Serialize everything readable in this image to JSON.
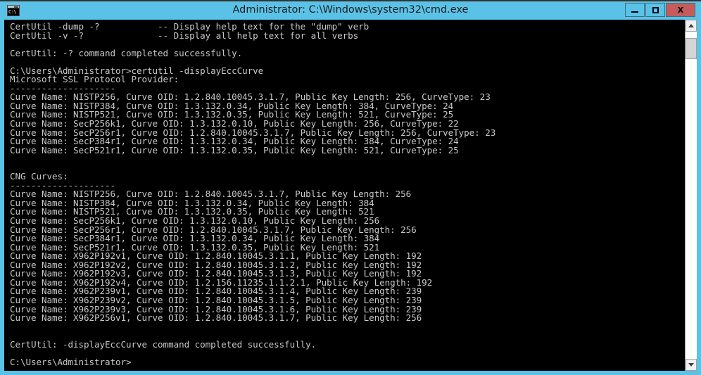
{
  "window": {
    "title": "Administrator: C:\\Windows\\system32\\cmd.exe",
    "icon_text": "C:\\",
    "titlebar_color": "#5bc2e7",
    "close_button_color": "#c75b5b",
    "controls": {
      "minimize_label": "",
      "maximize_label": "",
      "close_label": "X"
    }
  },
  "console": {
    "background_color": "#000000",
    "text_color": "#c8c8c8",
    "lines": [
      "CertUtil -dump -?           -- Display help text for the \"dump\" verb",
      "CertUtil -v -?              -- Display all help text for all verbs",
      "",
      "CertUtil: -? command completed successfully.",
      "",
      "C:\\Users\\Administrator>certutil -displayEccCurve",
      "Microsoft SSL Protocol Provider:",
      "--------------------",
      "Curve Name: NISTP256, Curve OID: 1.2.840.10045.3.1.7, Public Key Length: 256, CurveType: 23",
      "Curve Name: NISTP384, Curve OID: 1.3.132.0.34, Public Key Length: 384, CurveType: 24",
      "Curve Name: NISTP521, Curve OID: 1.3.132.0.35, Public Key Length: 521, CurveType: 25",
      "Curve Name: SecP256k1, Curve OID: 1.3.132.0.10, Public Key Length: 256, CurveType: 22",
      "Curve Name: SecP256r1, Curve OID: 1.2.840.10045.3.1.7, Public Key Length: 256, CurveType: 23",
      "Curve Name: SecP384r1, Curve OID: 1.3.132.0.34, Public Key Length: 384, CurveType: 24",
      "Curve Name: SecP521r1, Curve OID: 1.3.132.0.35, Public Key Length: 521, CurveType: 25",
      "",
      "",
      "CNG Curves:",
      "--------------------",
      "Curve Name: NISTP256, Curve OID: 1.2.840.10045.3.1.7, Public Key Length: 256",
      "Curve Name: NISTP384, Curve OID: 1.3.132.0.34, Public Key Length: 384",
      "Curve Name: NISTP521, Curve OID: 1.3.132.0.35, Public Key Length: 521",
      "Curve Name: SecP256k1, Curve OID: 1.3.132.0.10, Public Key Length: 256",
      "Curve Name: SecP256r1, Curve OID: 1.2.840.10045.3.1.7, Public Key Length: 256",
      "Curve Name: SecP384r1, Curve OID: 1.3.132.0.34, Public Key Length: 384",
      "Curve Name: SecP521r1, Curve OID: 1.3.132.0.35, Public Key Length: 521",
      "Curve Name: X962P192v1, Curve OID: 1.2.840.10045.3.1.1, Public Key Length: 192",
      "Curve Name: X962P192v2, Curve OID: 1.2.840.10045.3.1.2, Public Key Length: 192",
      "Curve Name: X962P192v3, Curve OID: 1.2.840.10045.3.1.3, Public Key Length: 192",
      "Curve Name: X962P192v4, Curve OID: 1.2.156.11235.1.1.2.1, Public Key Length: 192",
      "Curve Name: X962P239v1, Curve OID: 1.2.840.10045.3.1.4, Public Key Length: 239",
      "Curve Name: X962P239v2, Curve OID: 1.2.840.10045.3.1.5, Public Key Length: 239",
      "Curve Name: X962P239v3, Curve OID: 1.2.840.10045.3.1.6, Public Key Length: 239",
      "Curve Name: X962P256v1, Curve OID: 1.2.840.10045.3.1.7, Public Key Length: 256",
      "",
      "",
      "CertUtil: -displayEccCurve command completed successfully.",
      "",
      "C:\\Users\\Administrator>"
    ]
  },
  "scrollbar": {
    "up_arrow": "scroll-up",
    "down_arrow": "scroll-down",
    "thumb_position_percent": 2
  }
}
